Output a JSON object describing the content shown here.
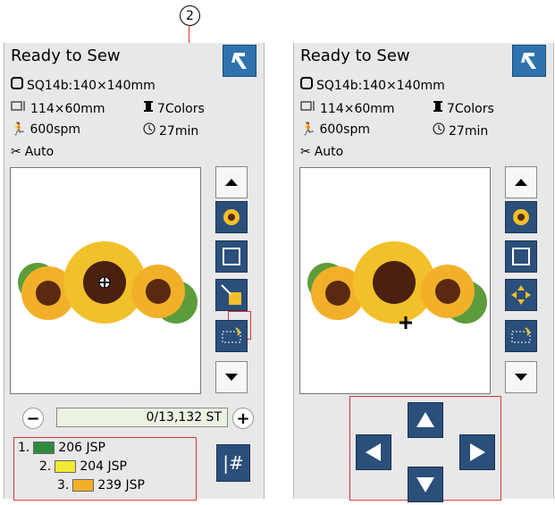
{
  "callout": {
    "number": "2"
  },
  "left_panel": {
    "title": "Ready to Sew",
    "hoop": "SQ14b:140×140mm",
    "size": "114×60mm",
    "colors": "7Colors",
    "speed": "600spm",
    "time": "27min",
    "cutter": "Auto",
    "stitch_count": "0/13,132 ST",
    "color_list": [
      {
        "index": "1.",
        "code": "206 JSP",
        "color": "#2e8b3e"
      },
      {
        "index": "2.",
        "code": "204 JSP",
        "color": "#f2ea35"
      },
      {
        "index": "3.",
        "code": "239 JSP",
        "color": "#f2b02a"
      }
    ],
    "hash_label": "|#"
  },
  "right_panel": {
    "title": "Ready to Sew",
    "hoop": "SQ14b:140×140mm",
    "size": "114×60mm",
    "colors": "7Colors",
    "speed": "600spm",
    "time": "27min",
    "cutter": "Auto"
  },
  "icons": {
    "back": "back-arrow-icon",
    "hoop": "hoop-icon",
    "size": "design-size-icon",
    "colors": "spool-icon",
    "speed": "runner-icon",
    "time": "clock-icon",
    "cutter": "thread-cutter-icon"
  },
  "accent": "#2e73ad",
  "highlight": "#d33333"
}
